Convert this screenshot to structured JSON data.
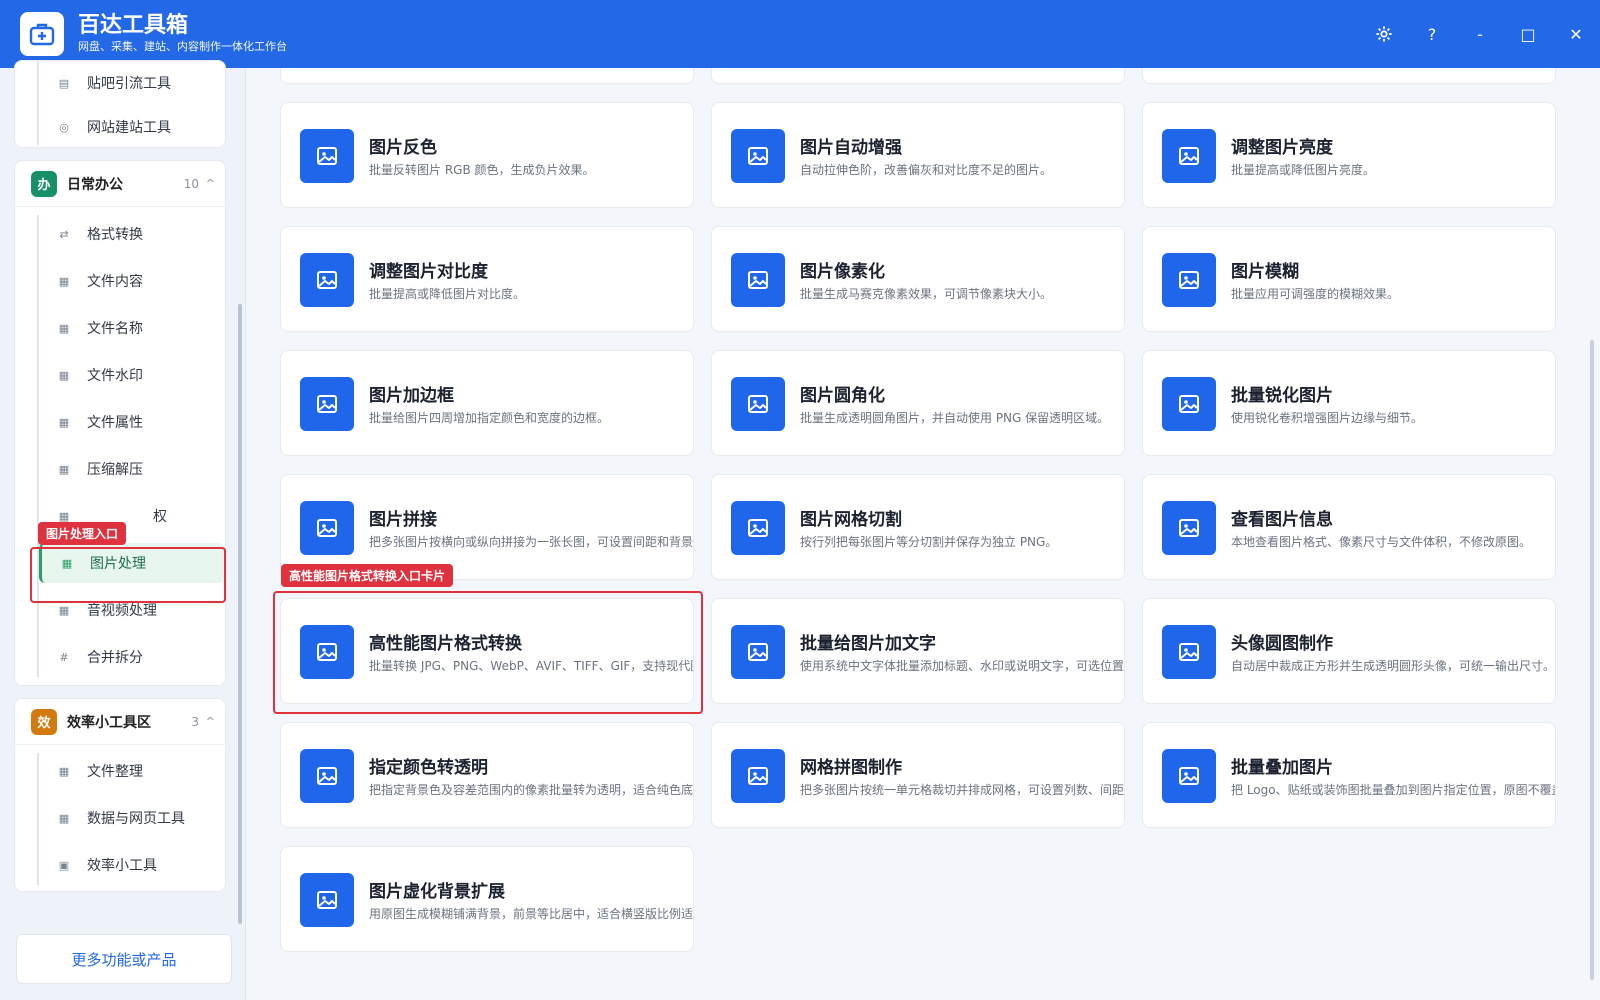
{
  "app": {
    "title": "百达工具箱",
    "subtitle": "网盘、采集、建站、内容制作一体化工作台",
    "brand_color": "#2368e6"
  },
  "window_controls": {
    "settings_icon": "gear-icon",
    "help_label": "?",
    "minimize_label": "-",
    "maximize_label": "□",
    "close_label": "✕"
  },
  "sidebar": {
    "top_items": [
      {
        "label": "贴吧引流工具",
        "icon": "list-icon"
      },
      {
        "label": "网站建站工具",
        "icon": "globe-icon"
      }
    ],
    "groups": [
      {
        "badge": "办",
        "badge_color": "#17906a",
        "name": "日常办公",
        "count": "10",
        "items": [
          {
            "label": "格式转换",
            "icon": "swap-icon"
          },
          {
            "label": "文件内容",
            "icon": "grid-icon"
          },
          {
            "label": "文件名称",
            "icon": "grid-icon"
          },
          {
            "label": "文件水印",
            "icon": "grid-icon"
          },
          {
            "label": "文件属性",
            "icon": "grid-icon"
          },
          {
            "label": "压缩解压",
            "icon": "grid-icon"
          },
          {
            "label": "权",
            "icon": "grid-icon"
          },
          {
            "label": "图片处理",
            "icon": "grid-icon",
            "active": true
          },
          {
            "label": "音视频处理",
            "icon": "grid-icon"
          },
          {
            "label": "合并拆分",
            "icon": "hash-icon"
          }
        ]
      },
      {
        "badge": "效",
        "badge_color": "#d37a0f",
        "name": "效率小工具区",
        "count": "3",
        "items": [
          {
            "label": "文件整理",
            "icon": "grid-icon"
          },
          {
            "label": "数据与网页工具",
            "icon": "grid-icon"
          },
          {
            "label": "效率小工具",
            "icon": "box-icon"
          }
        ]
      }
    ],
    "more_button": "更多功能或产品"
  },
  "annotations": {
    "sidebar_tag": "图片处理入口",
    "card_tag": "高性能图片格式转换入口卡片",
    "color": "#e0313f"
  },
  "tools": [
    {
      "title": "图片反色",
      "desc": "批量反转图片 RGB 颜色，生成负片效果。"
    },
    {
      "title": "图片自动增强",
      "desc": "自动拉伸色阶，改善偏灰和对比度不足的图片。"
    },
    {
      "title": "调整图片亮度",
      "desc": "批量提高或降低图片亮度。"
    },
    {
      "title": "调整图片对比度",
      "desc": "批量提高或降低图片对比度。"
    },
    {
      "title": "图片像素化",
      "desc": "批量生成马赛克像素效果，可调节像素块大小。"
    },
    {
      "title": "图片模糊",
      "desc": "批量应用可调强度的模糊效果。"
    },
    {
      "title": "图片加边框",
      "desc": "批量给图片四周增加指定颜色和宽度的边框。"
    },
    {
      "title": "图片圆角化",
      "desc": "批量生成透明圆角图片，并自动使用 PNG 保留透明区域。"
    },
    {
      "title": "批量锐化图片",
      "desc": "使用锐化卷积增强图片边缘与细节。"
    },
    {
      "title": "图片拼接",
      "desc": "把多张图片按横向或纵向拼接为一张长图，可设置间距和背景色。"
    },
    {
      "title": "图片网格切割",
      "desc": "按行列把每张图片等分切割并保存为独立 PNG。"
    },
    {
      "title": "查看图片信息",
      "desc": "本地查看图片格式、像素尺寸与文件体积，不修改原图。"
    },
    {
      "title": "高性能图片格式转换",
      "desc": "批量转换 JPG、PNG、WebP、AVIF、TIFF、GIF，支持现代图片"
    },
    {
      "title": "批量给图片加文字",
      "desc": "使用系统中文字体批量添加标题、水印或说明文字，可选位置、字"
    },
    {
      "title": "头像圆图制作",
      "desc": "自动居中裁成正方形并生成透明圆形头像，可统一输出尺寸。"
    },
    {
      "title": "指定颜色转透明",
      "desc": "把指定背景色及容差范围内的像素批量转为透明，适合纯色底素材"
    },
    {
      "title": "网格拼图制作",
      "desc": "把多张图片按统一单元格裁切并排成网格，可设置列数、间距和背"
    },
    {
      "title": "批量叠加图片",
      "desc": "把 Logo、贴纸或装饰图批量叠加到图片指定位置，原图不覆盖。"
    },
    {
      "title": "图片虚化背景扩展",
      "desc": "用原图生成模糊铺满背景，前景等比居中，适合横竖版比例适配。"
    }
  ]
}
